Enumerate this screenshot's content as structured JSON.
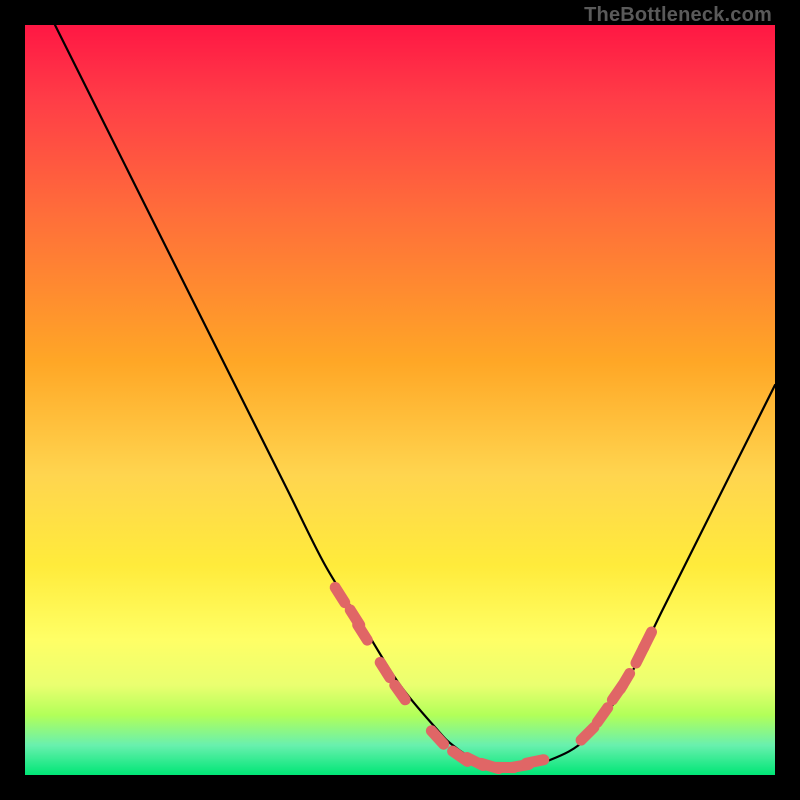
{
  "watermark": "TheBottleneck.com",
  "chart_data": {
    "type": "line",
    "title": "",
    "xlabel": "",
    "ylabel": "",
    "xlim": [
      0,
      100
    ],
    "ylim": [
      0,
      100
    ],
    "series": [
      {
        "name": "bottleneck-curve",
        "x": [
          4,
          10,
          15,
          20,
          25,
          30,
          35,
          40,
          45,
          50,
          55,
          57,
          60,
          63,
          65,
          70,
          75,
          80,
          85,
          90,
          95,
          100
        ],
        "y": [
          100,
          88,
          78,
          68,
          58,
          48,
          38,
          28,
          20,
          12,
          6,
          4,
          2,
          1,
          1,
          2,
          5,
          12,
          22,
          32,
          42,
          52
        ],
        "color": "#000000"
      }
    ],
    "markers": {
      "name": "highlight-dots",
      "color": "#e06666",
      "points": [
        {
          "x": 42,
          "y": 24
        },
        {
          "x": 44,
          "y": 21
        },
        {
          "x": 45,
          "y": 19
        },
        {
          "x": 48,
          "y": 14
        },
        {
          "x": 50,
          "y": 11
        },
        {
          "x": 55,
          "y": 5
        },
        {
          "x": 58,
          "y": 2.5
        },
        {
          "x": 60,
          "y": 1.8
        },
        {
          "x": 62,
          "y": 1.2
        },
        {
          "x": 64,
          "y": 1
        },
        {
          "x": 66,
          "y": 1.2
        },
        {
          "x": 68,
          "y": 1.8
        },
        {
          "x": 75,
          "y": 5.5
        },
        {
          "x": 77,
          "y": 8
        },
        {
          "x": 79,
          "y": 11
        },
        {
          "x": 80,
          "y": 12.5
        },
        {
          "x": 82,
          "y": 16
        },
        {
          "x": 83,
          "y": 18
        }
      ]
    }
  }
}
